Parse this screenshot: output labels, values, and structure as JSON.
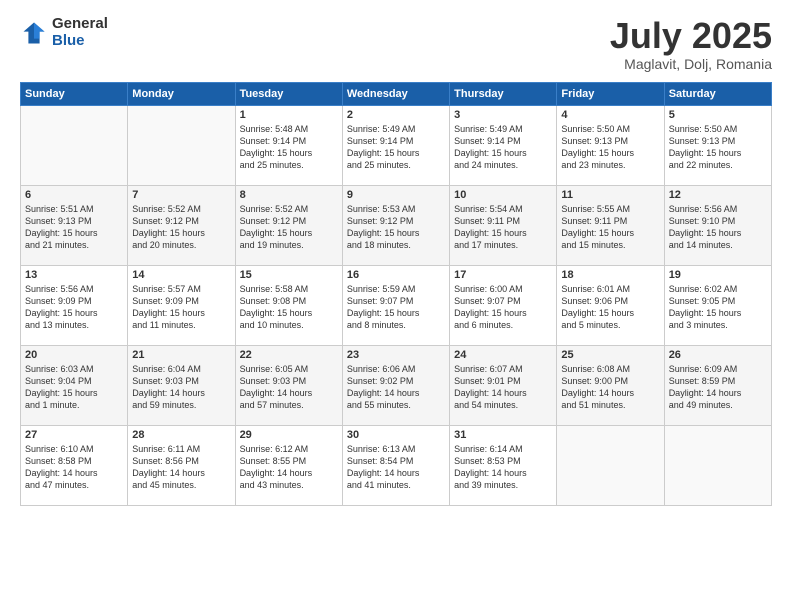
{
  "logo": {
    "general": "General",
    "blue": "Blue"
  },
  "title": "July 2025",
  "location": "Maglavit, Dolj, Romania",
  "days_header": [
    "Sunday",
    "Monday",
    "Tuesday",
    "Wednesday",
    "Thursday",
    "Friday",
    "Saturday"
  ],
  "weeks": [
    [
      {
        "day": "",
        "info": ""
      },
      {
        "day": "",
        "info": ""
      },
      {
        "day": "1",
        "info": "Sunrise: 5:48 AM\nSunset: 9:14 PM\nDaylight: 15 hours\nand 25 minutes."
      },
      {
        "day": "2",
        "info": "Sunrise: 5:49 AM\nSunset: 9:14 PM\nDaylight: 15 hours\nand 25 minutes."
      },
      {
        "day": "3",
        "info": "Sunrise: 5:49 AM\nSunset: 9:14 PM\nDaylight: 15 hours\nand 24 minutes."
      },
      {
        "day": "4",
        "info": "Sunrise: 5:50 AM\nSunset: 9:13 PM\nDaylight: 15 hours\nand 23 minutes."
      },
      {
        "day": "5",
        "info": "Sunrise: 5:50 AM\nSunset: 9:13 PM\nDaylight: 15 hours\nand 22 minutes."
      }
    ],
    [
      {
        "day": "6",
        "info": "Sunrise: 5:51 AM\nSunset: 9:13 PM\nDaylight: 15 hours\nand 21 minutes."
      },
      {
        "day": "7",
        "info": "Sunrise: 5:52 AM\nSunset: 9:12 PM\nDaylight: 15 hours\nand 20 minutes."
      },
      {
        "day": "8",
        "info": "Sunrise: 5:52 AM\nSunset: 9:12 PM\nDaylight: 15 hours\nand 19 minutes."
      },
      {
        "day": "9",
        "info": "Sunrise: 5:53 AM\nSunset: 9:12 PM\nDaylight: 15 hours\nand 18 minutes."
      },
      {
        "day": "10",
        "info": "Sunrise: 5:54 AM\nSunset: 9:11 PM\nDaylight: 15 hours\nand 17 minutes."
      },
      {
        "day": "11",
        "info": "Sunrise: 5:55 AM\nSunset: 9:11 PM\nDaylight: 15 hours\nand 15 minutes."
      },
      {
        "day": "12",
        "info": "Sunrise: 5:56 AM\nSunset: 9:10 PM\nDaylight: 15 hours\nand 14 minutes."
      }
    ],
    [
      {
        "day": "13",
        "info": "Sunrise: 5:56 AM\nSunset: 9:09 PM\nDaylight: 15 hours\nand 13 minutes."
      },
      {
        "day": "14",
        "info": "Sunrise: 5:57 AM\nSunset: 9:09 PM\nDaylight: 15 hours\nand 11 minutes."
      },
      {
        "day": "15",
        "info": "Sunrise: 5:58 AM\nSunset: 9:08 PM\nDaylight: 15 hours\nand 10 minutes."
      },
      {
        "day": "16",
        "info": "Sunrise: 5:59 AM\nSunset: 9:07 PM\nDaylight: 15 hours\nand 8 minutes."
      },
      {
        "day": "17",
        "info": "Sunrise: 6:00 AM\nSunset: 9:07 PM\nDaylight: 15 hours\nand 6 minutes."
      },
      {
        "day": "18",
        "info": "Sunrise: 6:01 AM\nSunset: 9:06 PM\nDaylight: 15 hours\nand 5 minutes."
      },
      {
        "day": "19",
        "info": "Sunrise: 6:02 AM\nSunset: 9:05 PM\nDaylight: 15 hours\nand 3 minutes."
      }
    ],
    [
      {
        "day": "20",
        "info": "Sunrise: 6:03 AM\nSunset: 9:04 PM\nDaylight: 15 hours\nand 1 minute."
      },
      {
        "day": "21",
        "info": "Sunrise: 6:04 AM\nSunset: 9:03 PM\nDaylight: 14 hours\nand 59 minutes."
      },
      {
        "day": "22",
        "info": "Sunrise: 6:05 AM\nSunset: 9:03 PM\nDaylight: 14 hours\nand 57 minutes."
      },
      {
        "day": "23",
        "info": "Sunrise: 6:06 AM\nSunset: 9:02 PM\nDaylight: 14 hours\nand 55 minutes."
      },
      {
        "day": "24",
        "info": "Sunrise: 6:07 AM\nSunset: 9:01 PM\nDaylight: 14 hours\nand 54 minutes."
      },
      {
        "day": "25",
        "info": "Sunrise: 6:08 AM\nSunset: 9:00 PM\nDaylight: 14 hours\nand 51 minutes."
      },
      {
        "day": "26",
        "info": "Sunrise: 6:09 AM\nSunset: 8:59 PM\nDaylight: 14 hours\nand 49 minutes."
      }
    ],
    [
      {
        "day": "27",
        "info": "Sunrise: 6:10 AM\nSunset: 8:58 PM\nDaylight: 14 hours\nand 47 minutes."
      },
      {
        "day": "28",
        "info": "Sunrise: 6:11 AM\nSunset: 8:56 PM\nDaylight: 14 hours\nand 45 minutes."
      },
      {
        "day": "29",
        "info": "Sunrise: 6:12 AM\nSunset: 8:55 PM\nDaylight: 14 hours\nand 43 minutes."
      },
      {
        "day": "30",
        "info": "Sunrise: 6:13 AM\nSunset: 8:54 PM\nDaylight: 14 hours\nand 41 minutes."
      },
      {
        "day": "31",
        "info": "Sunrise: 6:14 AM\nSunset: 8:53 PM\nDaylight: 14 hours\nand 39 minutes."
      },
      {
        "day": "",
        "info": ""
      },
      {
        "day": "",
        "info": ""
      }
    ]
  ]
}
